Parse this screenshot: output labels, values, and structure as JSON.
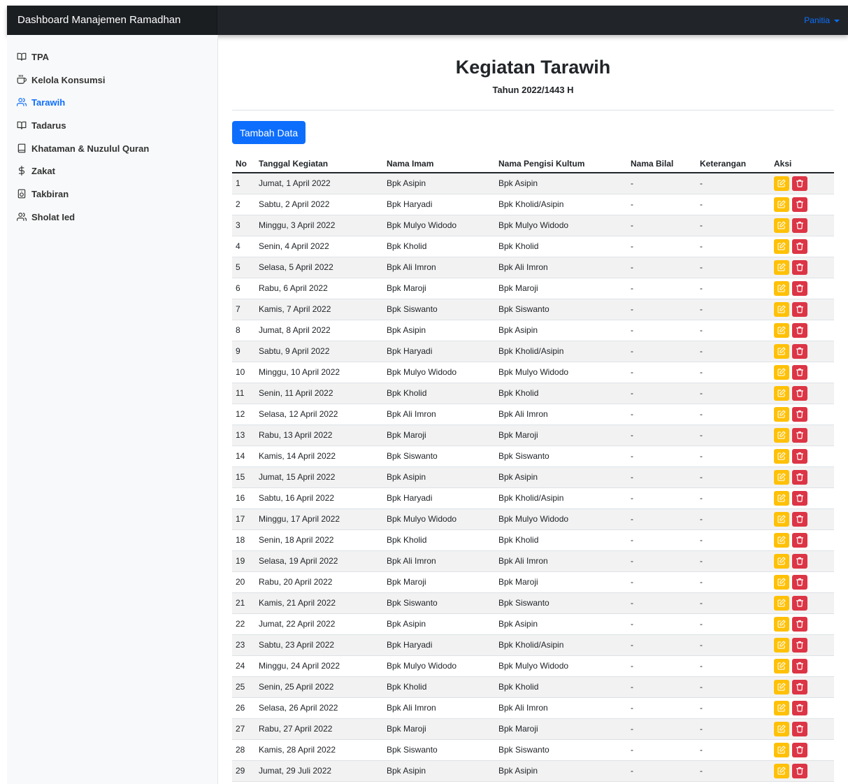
{
  "app": {
    "title": "Dashboard Manajemen Ramadhan",
    "user_menu": "Panitia"
  },
  "sidebar": {
    "items": [
      {
        "label": "TPA",
        "icon": "book-open-icon",
        "active": false
      },
      {
        "label": "Kelola Konsumsi",
        "icon": "coffee-icon",
        "active": false
      },
      {
        "label": "Tarawih",
        "icon": "users-icon",
        "active": true
      },
      {
        "label": "Tadarus",
        "icon": "book-open-icon",
        "active": false
      },
      {
        "label": "Khataman & Nuzulul Quran",
        "icon": "book-icon",
        "active": false
      },
      {
        "label": "Zakat",
        "icon": "dollar-sign-icon",
        "active": false
      },
      {
        "label": "Takbiran",
        "icon": "speaker-icon",
        "active": false
      },
      {
        "label": "Sholat Ied",
        "icon": "users-icon",
        "active": false
      }
    ]
  },
  "page": {
    "title": "Kegiatan Tarawih",
    "subtitle": "Tahun 2022/1443 H",
    "add_button": "Tambah Data"
  },
  "table": {
    "headers": [
      "No",
      "Tanggal Kegiatan",
      "Nama Imam",
      "Nama Pengisi Kultum",
      "Nama Bilal",
      "Keterangan",
      "Aksi"
    ],
    "rows": [
      [
        "1",
        "Jumat, 1 April 2022",
        "Bpk Asipin",
        "Bpk Asipin",
        "-",
        "-"
      ],
      [
        "2",
        "Sabtu, 2 April 2022",
        "Bpk Haryadi",
        "Bpk Kholid/Asipin",
        "-",
        "-"
      ],
      [
        "3",
        "Minggu, 3 April 2022",
        "Bpk Mulyo Widodo",
        "Bpk Mulyo Widodo",
        "-",
        "-"
      ],
      [
        "4",
        "Senin, 4 April 2022",
        "Bpk Kholid",
        "Bpk Kholid",
        "-",
        "-"
      ],
      [
        "5",
        "Selasa, 5 April 2022",
        "Bpk Ali Imron",
        "Bpk Ali Imron",
        "-",
        "-"
      ],
      [
        "6",
        "Rabu, 6 April 2022",
        "Bpk Maroji",
        "Bpk Maroji",
        "-",
        "-"
      ],
      [
        "7",
        "Kamis, 7 April 2022",
        "Bpk Siswanto",
        "Bpk Siswanto",
        "-",
        "-"
      ],
      [
        "8",
        "Jumat, 8 April 2022",
        "Bpk Asipin",
        "Bpk Asipin",
        "-",
        "-"
      ],
      [
        "9",
        "Sabtu, 9 April 2022",
        "Bpk Haryadi",
        "Bpk Kholid/Asipin",
        "-",
        "-"
      ],
      [
        "10",
        "Minggu, 10 April 2022",
        "Bpk Mulyo Widodo",
        "Bpk Mulyo Widodo",
        "-",
        "-"
      ],
      [
        "11",
        "Senin, 11 April 2022",
        "Bpk Kholid",
        "Bpk Kholid",
        "-",
        "-"
      ],
      [
        "12",
        "Selasa, 12 April 2022",
        "Bpk Ali Imron",
        "Bpk Ali Imron",
        "-",
        "-"
      ],
      [
        "13",
        "Rabu, 13 April 2022",
        "Bpk Maroji",
        "Bpk Maroji",
        "-",
        "-"
      ],
      [
        "14",
        "Kamis, 14 April 2022",
        "Bpk Siswanto",
        "Bpk Siswanto",
        "-",
        "-"
      ],
      [
        "15",
        "Jumat, 15 April 2022",
        "Bpk Asipin",
        "Bpk Asipin",
        "-",
        "-"
      ],
      [
        "16",
        "Sabtu, 16 April 2022",
        "Bpk Haryadi",
        "Bpk Kholid/Asipin",
        "-",
        "-"
      ],
      [
        "17",
        "Minggu, 17 April 2022",
        "Bpk Mulyo Widodo",
        "Bpk Mulyo Widodo",
        "-",
        "-"
      ],
      [
        "18",
        "Senin, 18 April 2022",
        "Bpk Kholid",
        "Bpk Kholid",
        "-",
        "-"
      ],
      [
        "19",
        "Selasa, 19 April 2022",
        "Bpk Ali Imron",
        "Bpk Ali Imron",
        "-",
        "-"
      ],
      [
        "20",
        "Rabu, 20 April 2022",
        "Bpk Maroji",
        "Bpk Maroji",
        "-",
        "-"
      ],
      [
        "21",
        "Kamis, 21 April 2022",
        "Bpk Siswanto",
        "Bpk Siswanto",
        "-",
        "-"
      ],
      [
        "22",
        "Jumat, 22 April 2022",
        "Bpk Asipin",
        "Bpk Asipin",
        "-",
        "-"
      ],
      [
        "23",
        "Sabtu, 23 April 2022",
        "Bpk Haryadi",
        "Bpk Kholid/Asipin",
        "-",
        "-"
      ],
      [
        "24",
        "Minggu, 24 April 2022",
        "Bpk Mulyo Widodo",
        "Bpk Mulyo Widodo",
        "-",
        "-"
      ],
      [
        "25",
        "Senin, 25 April 2022",
        "Bpk Kholid",
        "Bpk Kholid",
        "-",
        "-"
      ],
      [
        "26",
        "Selasa, 26 April 2022",
        "Bpk Ali Imron",
        "Bpk Ali Imron",
        "-",
        "-"
      ],
      [
        "27",
        "Rabu, 27 April 2022",
        "Bpk Maroji",
        "Bpk Maroji",
        "-",
        "-"
      ],
      [
        "28",
        "Kamis, 28 April 2022",
        "Bpk Siswanto",
        "Bpk Siswanto",
        "-",
        "-"
      ],
      [
        "29",
        "Jumat, 29 Juli 2022",
        "Bpk Asipin",
        "Bpk Asipin",
        "-",
        "-"
      ]
    ]
  },
  "colors": {
    "accent": "#0d6efd",
    "navbar": "#212529",
    "edit": "#ffc107",
    "delete": "#dc3545",
    "stripe": "#f2f2f2"
  }
}
